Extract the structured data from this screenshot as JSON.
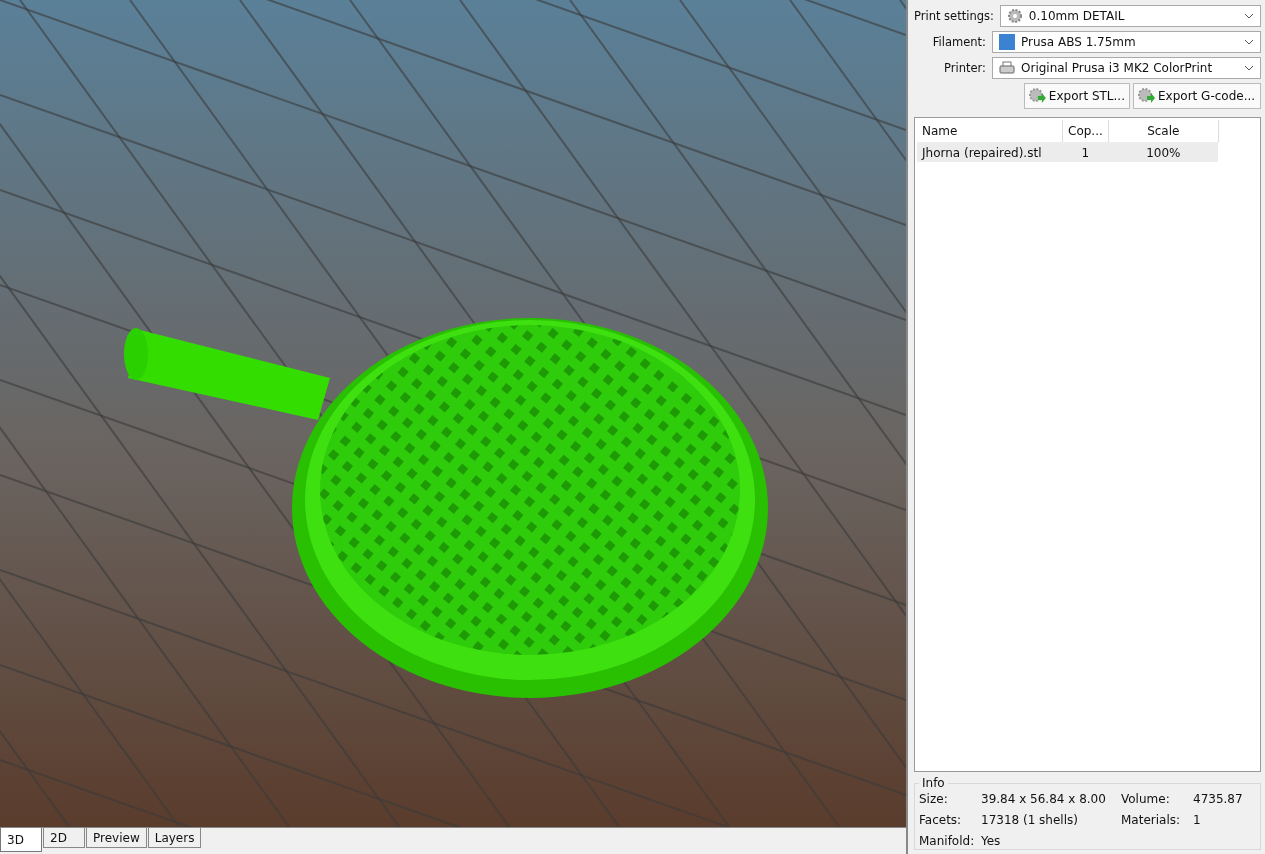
{
  "viewport": {
    "kind": "picture"
  },
  "view_tabs": [
    {
      "label": "3D",
      "selected": true
    },
    {
      "label": "2D",
      "selected": false
    },
    {
      "label": "Preview",
      "selected": false
    },
    {
      "label": "Layers",
      "selected": false
    }
  ],
  "settings": [
    {
      "label": "Print settings:",
      "value": "0.10mm DETAIL",
      "kind": "gear"
    },
    {
      "label": "Filament:",
      "value": "Prusa ABS 1.75mm",
      "kind": "swatch",
      "color": "#3c82d2"
    },
    {
      "label": "Printer:",
      "value": "Original Prusa i3 MK2 ColorPrint",
      "kind": "printer"
    }
  ],
  "buttons": [
    "Export STL...",
    "Export G-code..."
  ],
  "table": {
    "columns": [
      "Name",
      "Cop...",
      "Scale"
    ],
    "rows": [
      {
        "cells": [
          "Jhorna (repaired).stl",
          "1",
          "100%"
        ],
        "selected": true
      }
    ]
  },
  "info": {
    "title": "Info",
    "fields": [
      {
        "label": "Size:",
        "value": "39.84 x 56.84 x 8.00"
      },
      {
        "label": "Volume:",
        "value": "4735.87"
      },
      {
        "label": "Facets:",
        "value": "17318 (1 shells)"
      },
      {
        "label": "Materials:",
        "value": "1"
      },
      {
        "label": "Manifold:",
        "value": "Yes"
      }
    ]
  }
}
